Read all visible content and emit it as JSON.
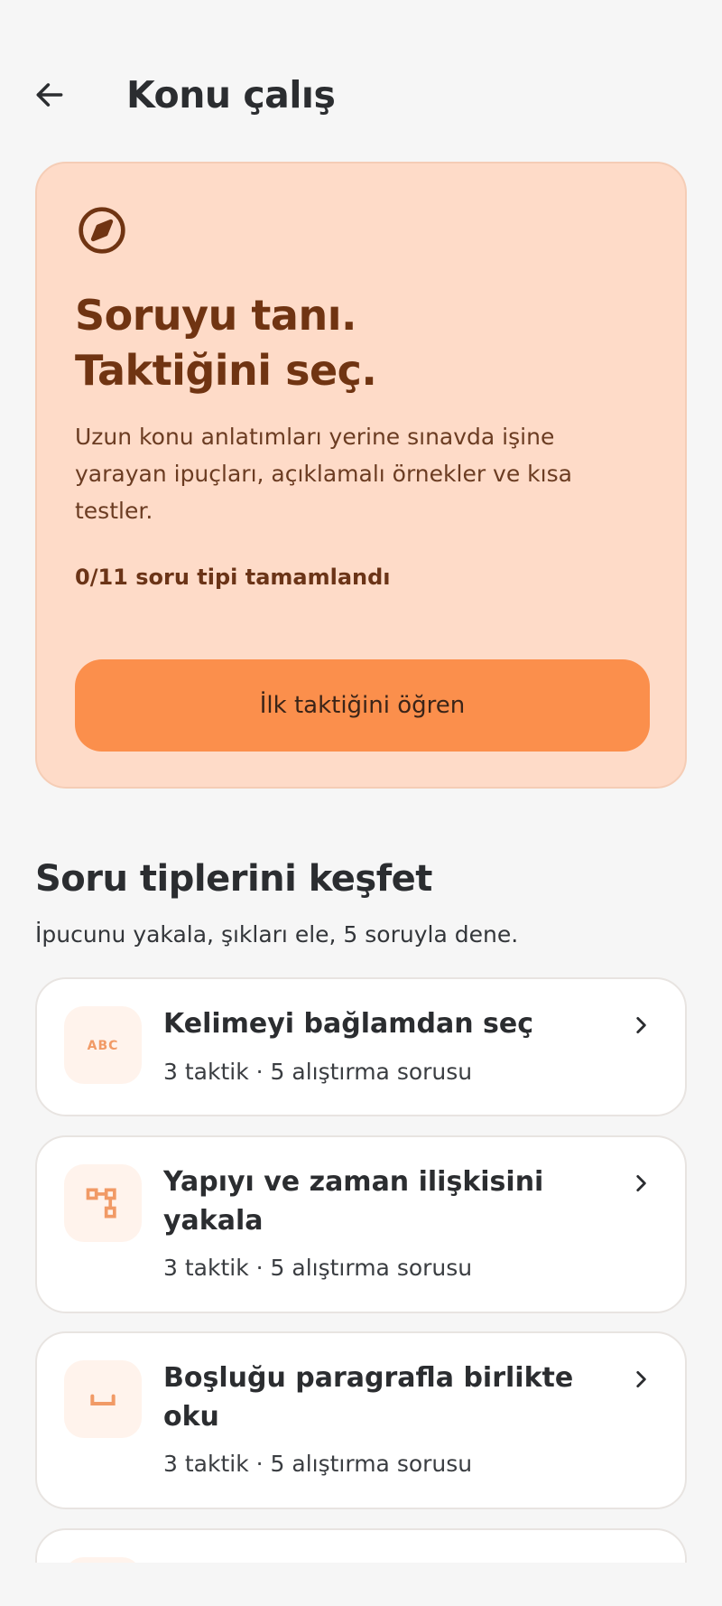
{
  "header": {
    "title": "Konu çalış"
  },
  "hero": {
    "title_line1": "Soruyu tanı.",
    "title_line2": "Taktiğini seç.",
    "description": "Uzun konu anlatımları yerine sınavda işine yarayan ipuçları, açıklamalı örnekler ve kısa testler.",
    "progress": "0/11 soru tipi tamamlandı",
    "button_label": "İlk taktiğini öğren"
  },
  "section": {
    "title": "Soru tiplerini keşfet",
    "subtitle": "İpucunu yakala, şıkları ele, 5 soruyla dene."
  },
  "cards": [
    {
      "title": "Kelimeyi bağlamdan seç",
      "meta": "3 taktik · 5 alıştırma sorusu",
      "icon": "abc-icon"
    },
    {
      "title": "Yapıyı ve zaman ilişkisini yakala",
      "meta": "3 taktik · 5 alıştırma sorusu",
      "icon": "structure-icon"
    },
    {
      "title": "Boşluğu paragrafla birlikte oku",
      "meta": "3 taktik · 5 alıştırma sorusu",
      "icon": "blank-space-icon"
    }
  ],
  "colors": {
    "accent": "#fb8f4c",
    "hero_bg": "#fedbc8",
    "hero_text": "#703412",
    "icon_accent": "#f19a66"
  }
}
